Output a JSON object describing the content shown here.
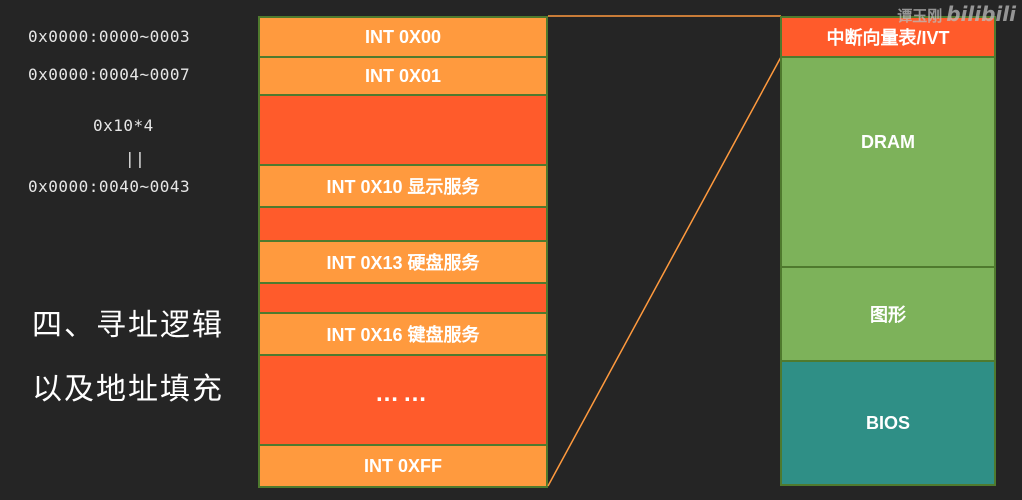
{
  "addresses": {
    "row0": "0x0000:0000~0003",
    "row1": "0x0000:0004~0007",
    "formula": "0x10*4",
    "equals": "||",
    "row10": "0x0000:0040~0043"
  },
  "heading": {
    "line1": "四、寻址逻辑",
    "line2": "以及地址填充"
  },
  "ivt_table": {
    "entries": [
      "INT 0X00",
      "INT 0X01",
      "",
      "INT 0X10 显示服务",
      "",
      "INT 0X13 硬盘服务",
      "",
      "INT 0X16 键盘服务",
      "……",
      "INT 0XFF"
    ]
  },
  "memory_map": {
    "segments": [
      "中断向量表/IVT",
      "DRAM",
      "图形",
      "BIOS"
    ]
  },
  "watermark": {
    "author": "谭玉刚",
    "logo": "bilibili"
  },
  "colors": {
    "background": "#252525",
    "entry_light": "#ff9a3e",
    "entry_dark": "#ff5b2b",
    "dram": "#7db25a",
    "bios": "#2f8f86",
    "connector": "#ff9a3e"
  }
}
